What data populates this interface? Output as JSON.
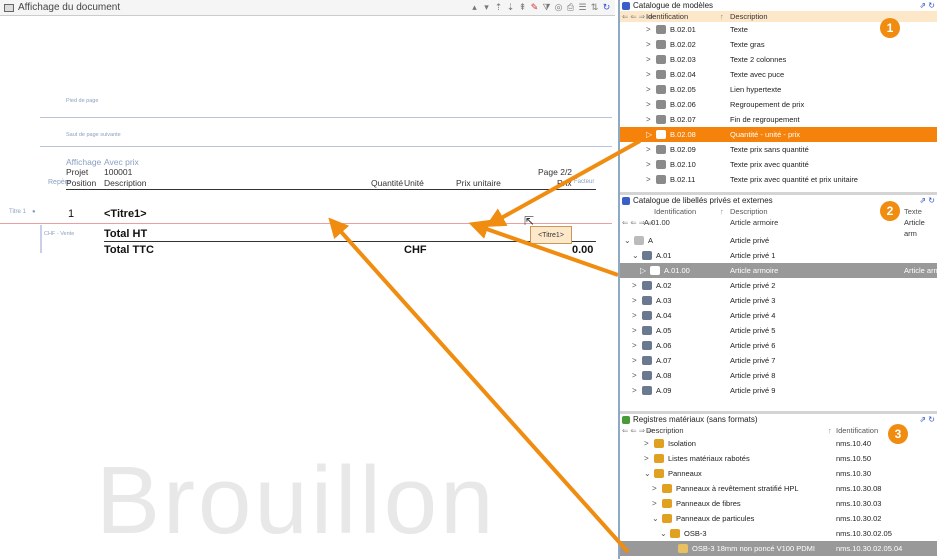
{
  "doc_window": {
    "title": "Affichage du document",
    "pied_label": "Pied de page",
    "saut_label": "Saut de page suivante",
    "affichage_label": "Affichage",
    "affichage_value": "Avec prix",
    "projet_label": "Projet",
    "projet_value": "100001",
    "page_label": "Page 2/2",
    "col_repere": "Repère",
    "col_position": "Position",
    "col_description": "Description",
    "col_quantite": "Quantité",
    "col_unite": "Unité",
    "col_prix_unitaire": "Prix unitaire",
    "col_prix": "Prix",
    "col_facteur": "Facteur",
    "titre_level": "Titre 1",
    "titre_number": "1",
    "titre_text": "<Titre1>",
    "chf_label": "CHF - Vente",
    "total_ht": "Total HT",
    "total_ttc": "Total TTC",
    "currency": "CHF",
    "total_value": "0.00",
    "tooltip": "<Titre1>",
    "watermark": "Brouillon"
  },
  "panel1": {
    "title": "Catalogue de modèles",
    "col_id": "Identification",
    "col_desc": "Description",
    "badge": "1",
    "rows": [
      {
        "code": "B.02.01",
        "desc": "Texte"
      },
      {
        "code": "B.02.02",
        "desc": "Texte gras"
      },
      {
        "code": "B.02.03",
        "desc": "Texte 2 colonnes"
      },
      {
        "code": "B.02.04",
        "desc": "Texte avec puce"
      },
      {
        "code": "B.02.05",
        "desc": "Lien hypertexte"
      },
      {
        "code": "B.02.06",
        "desc": "Regroupement de prix"
      },
      {
        "code": "B.02.07",
        "desc": "Fin de regroupement"
      },
      {
        "code": "B.02.08",
        "desc": "Quantité - unité - prix"
      },
      {
        "code": "B.02.09",
        "desc": "Texte prix sans quantité"
      },
      {
        "code": "B.02.10",
        "desc": "Texte prix avec quantité"
      },
      {
        "code": "B.02.11",
        "desc": "Texte prix avec quantité et prix unitaire"
      }
    ]
  },
  "panel2": {
    "title": "Catalogue de libellés privés et externes",
    "col_id": "Identification",
    "col_desc": "Description",
    "col_text": "Texte",
    "filter_code": "A.01.00",
    "filter_desc": "Article armoire",
    "filter_text": "Article arm",
    "badge": "2",
    "rows": [
      {
        "code": "A",
        "desc": "Article privé",
        "extra": ""
      },
      {
        "code": "A.01",
        "desc": "Article privé 1",
        "extra": ""
      },
      {
        "code": "A.01.00",
        "desc": "Article armoire",
        "extra": "Article arm"
      },
      {
        "code": "A.02",
        "desc": "Article privé 2",
        "extra": ""
      },
      {
        "code": "A.03",
        "desc": "Article privé 3",
        "extra": ""
      },
      {
        "code": "A.04",
        "desc": "Article privé 4",
        "extra": ""
      },
      {
        "code": "A.05",
        "desc": "Article privé 5",
        "extra": ""
      },
      {
        "code": "A.06",
        "desc": "Article privé 6",
        "extra": ""
      },
      {
        "code": "A.07",
        "desc": "Article privé 7",
        "extra": ""
      },
      {
        "code": "A.08",
        "desc": "Article privé 8",
        "extra": ""
      },
      {
        "code": "A.09",
        "desc": "Article privé 9",
        "extra": ""
      }
    ]
  },
  "panel3": {
    "title": "Registres matériaux (sans formats)",
    "col_desc": "Description",
    "col_id": "Identification",
    "badge": "3",
    "rows": [
      {
        "desc": "Isolation",
        "code": "nms.10.40"
      },
      {
        "desc": "Listes matériaux rabotés",
        "code": "nms.10.50"
      },
      {
        "desc": "Panneaux",
        "code": "nms.10.30"
      },
      {
        "desc": "Panneaux à revêtement stratifié HPL",
        "code": "nms.10.30.08"
      },
      {
        "desc": "Panneaux de fibres",
        "code": "nms.10.30.03"
      },
      {
        "desc": "Panneaux de particules",
        "code": "nms.10.30.02"
      },
      {
        "desc": "OSB-3",
        "code": "nms.10.30.02.05"
      },
      {
        "desc": "OSB-3 18mm non poncé V100 PDMI",
        "code": "nms.10.30.02.05.04"
      }
    ]
  }
}
